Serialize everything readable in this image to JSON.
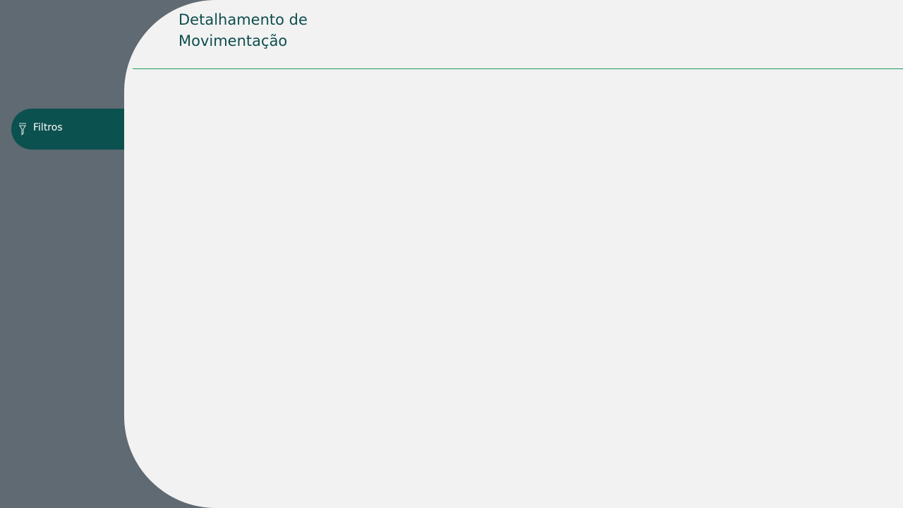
{
  "sidebar": {
    "filter_button": {
      "label": "Filtros",
      "icon": "filter-icon"
    }
  },
  "header": {
    "title": "Detalhamento de Movimentação"
  },
  "colors": {
    "sidebar_background": "#5f6a72",
    "content_background": "#f2f2f2",
    "filter_button_background": "#0b514f",
    "title_text": "#0f4d4f",
    "divider": "#1b9a5c"
  }
}
